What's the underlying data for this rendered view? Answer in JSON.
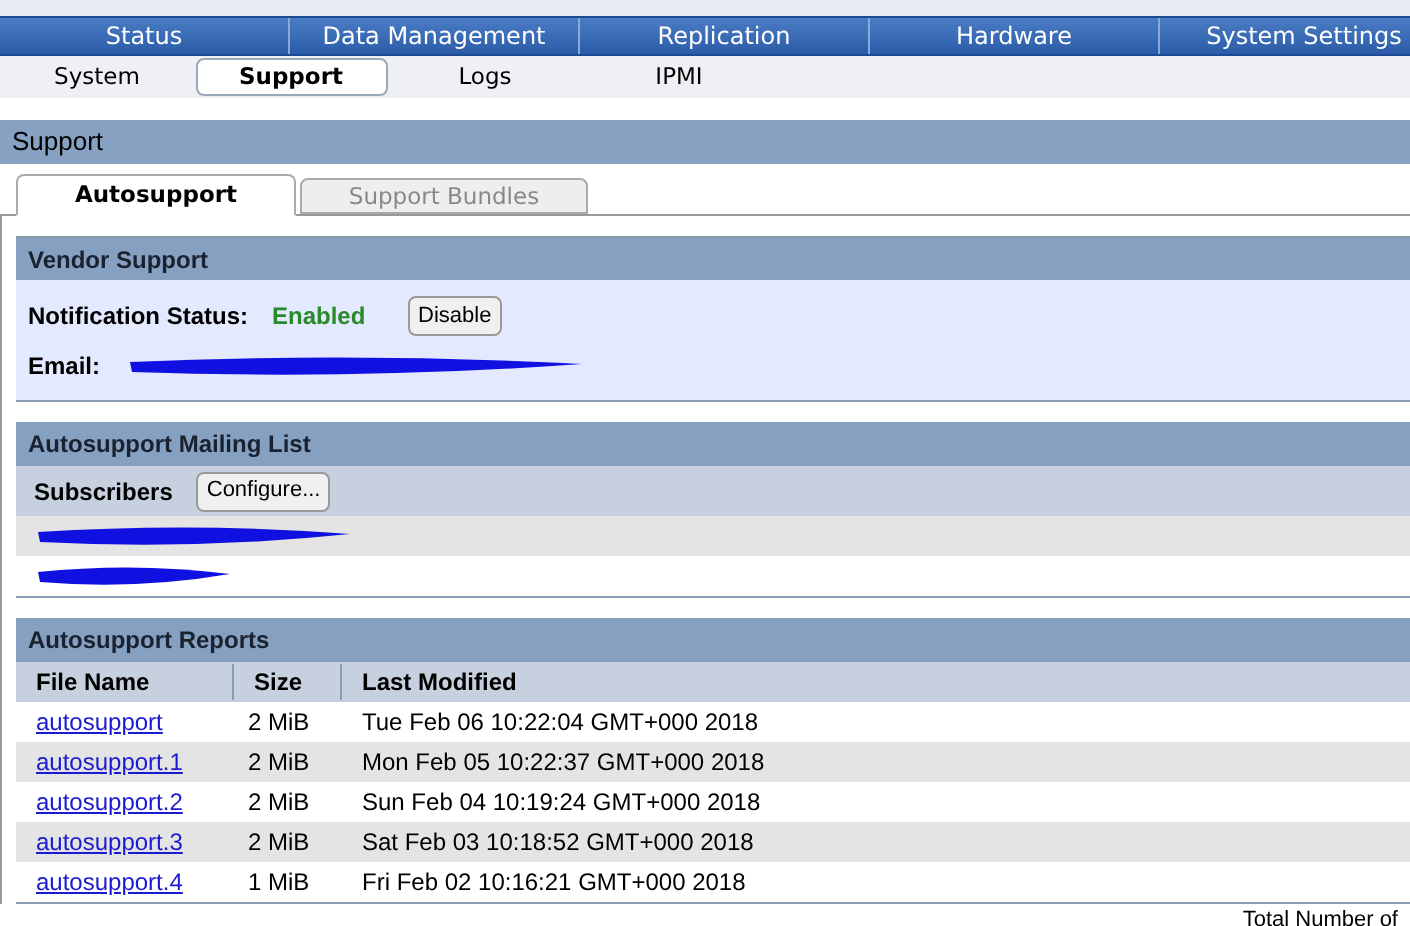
{
  "nav": [
    {
      "label": "Status",
      "selected": false
    },
    {
      "label": "Data Management",
      "selected": false
    },
    {
      "label": "Replication",
      "selected": false
    },
    {
      "label": "Hardware",
      "selected": false
    },
    {
      "label": "System Settings",
      "selected": false
    }
  ],
  "subnav": [
    {
      "label": "System",
      "selected": false
    },
    {
      "label": "Support",
      "selected": true
    },
    {
      "label": "Logs",
      "selected": false
    },
    {
      "label": "IPMI",
      "selected": false
    }
  ],
  "page_title": "Support",
  "tabs": [
    {
      "label": "Autosupport",
      "selected": true
    },
    {
      "label": "Support Bundles",
      "selected": false
    }
  ],
  "vendor_support": {
    "title": "Vendor Support",
    "status_label": "Notification Status:",
    "status": "Enabled",
    "button": "Disable",
    "email_label": "Email:"
  },
  "mailing_list": {
    "title": "Autosupport Mailing List",
    "subscribers_label": "Subscribers",
    "button": "Configure..."
  },
  "reports": {
    "title": "Autosupport Reports",
    "columns": [
      "File Name",
      "Size",
      "Last Modified"
    ],
    "rows": [
      [
        "autosupport",
        "2 MiB",
        "Tue Feb 06 10:22:04 GMT+000 2018"
      ],
      [
        "autosupport.1",
        "2 MiB",
        "Mon Feb 05 10:22:37 GMT+000 2018"
      ],
      [
        "autosupport.2",
        "2 MiB",
        "Sun Feb 04 10:19:24 GMT+000 2018"
      ],
      [
        "autosupport.3",
        "2 MiB",
        "Sat Feb 03 10:18:52 GMT+000 2018"
      ],
      [
        "autosupport.4",
        "1 MiB",
        "Fri Feb 02 10:16:21 GMT+000 2018"
      ]
    ],
    "footer": "Total Number of"
  }
}
